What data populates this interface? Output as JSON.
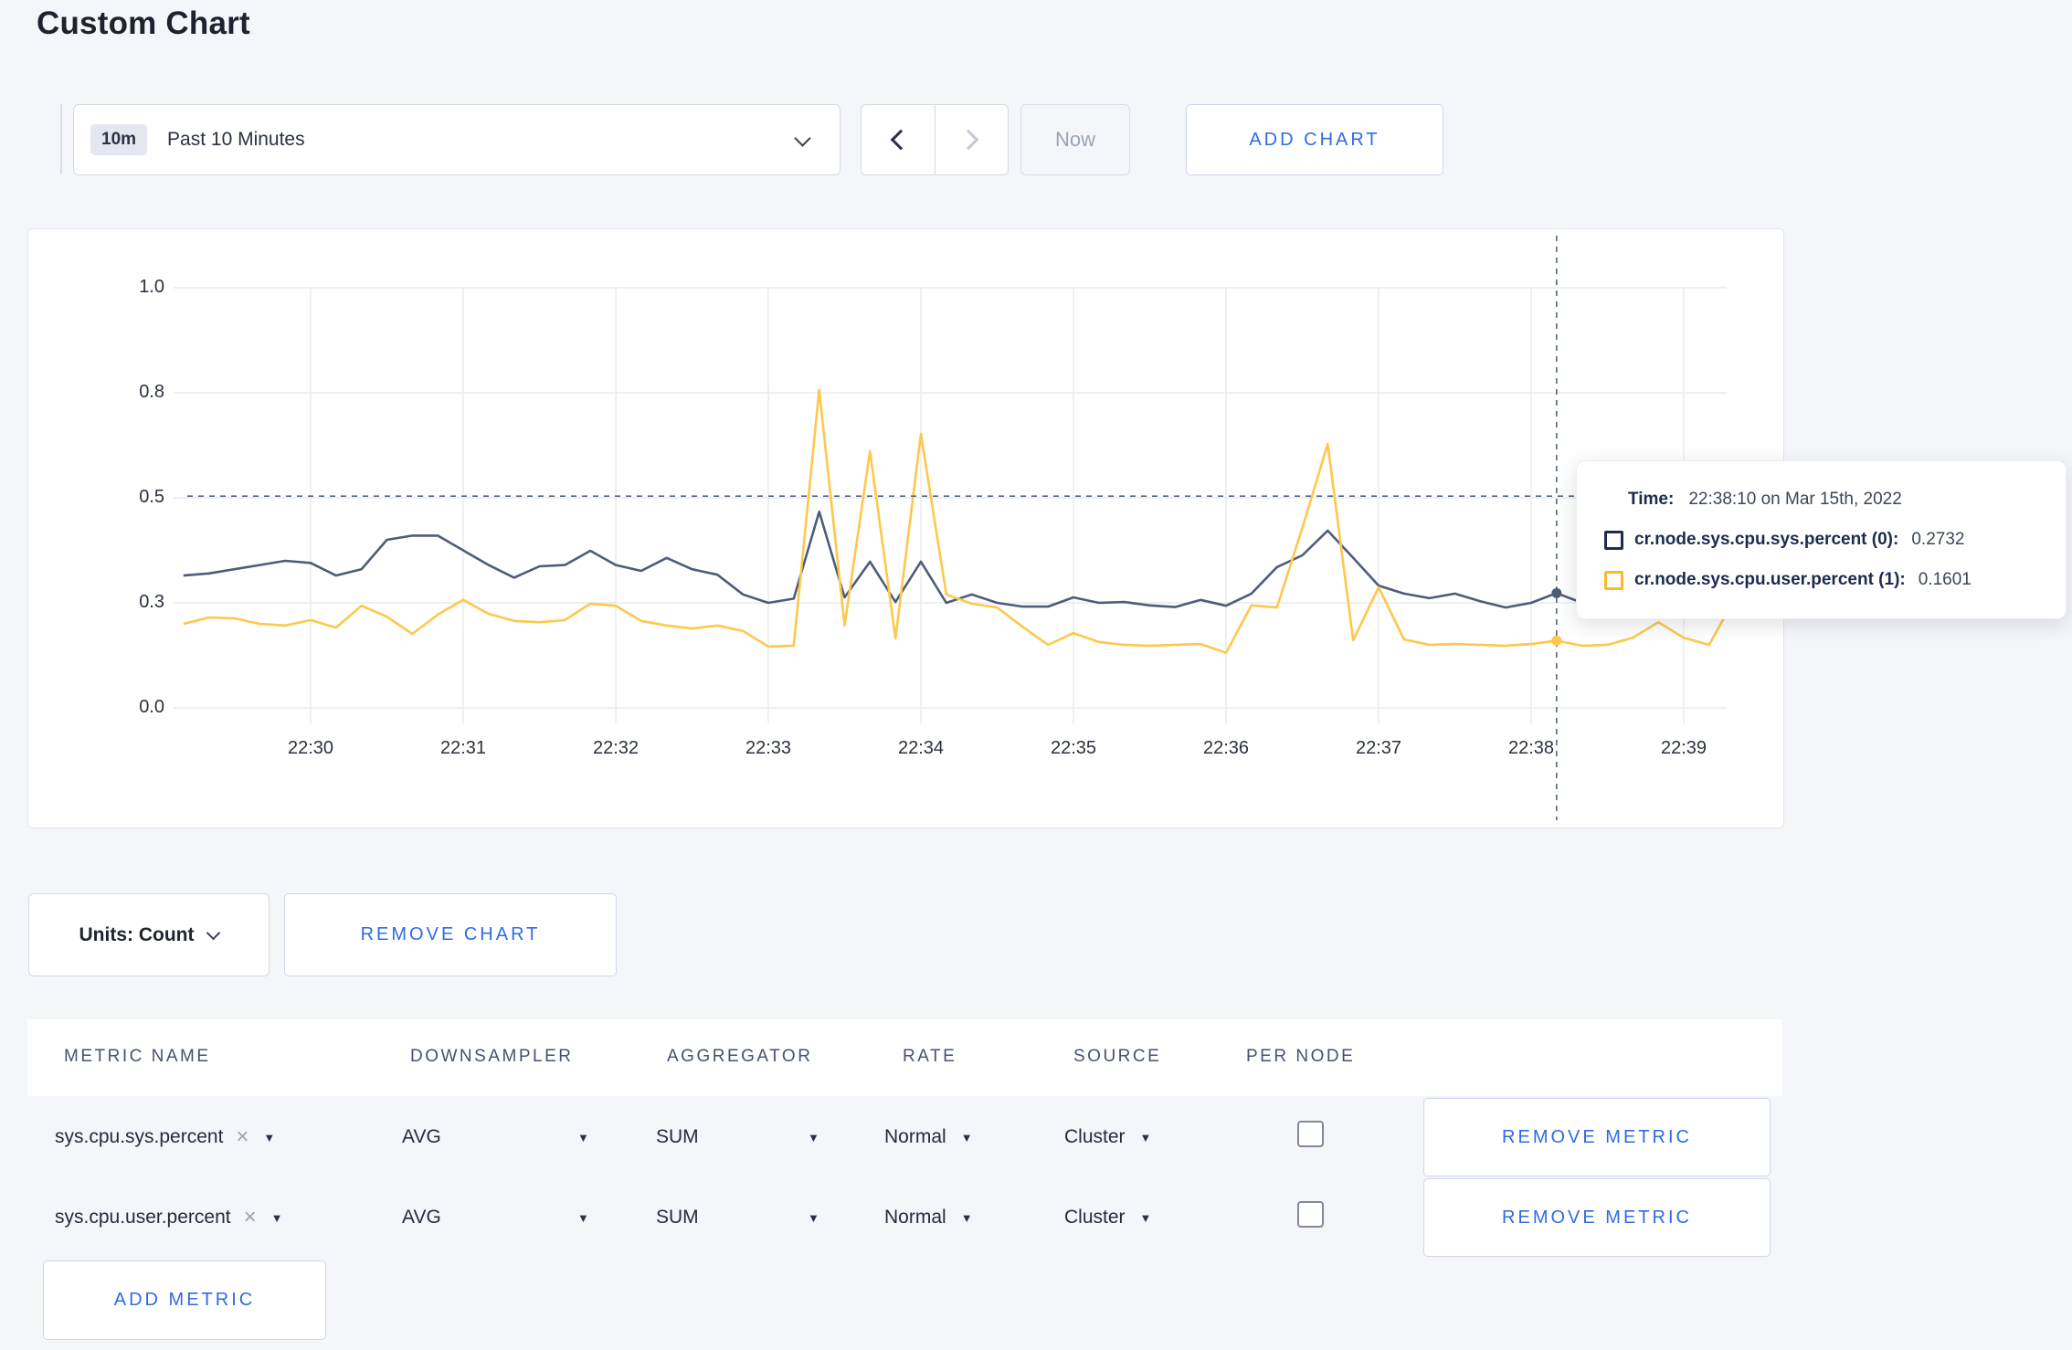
{
  "page": {
    "title": "Custom Chart"
  },
  "toolbar": {
    "time_window_badge": "10m",
    "time_window_label": "Past 10 Minutes",
    "now_label": "Now",
    "add_chart_label": "ADD CHART"
  },
  "chart_data": {
    "type": "line",
    "title": "",
    "xlabel": "",
    "ylabel": "",
    "ylim": [
      0,
      1
    ],
    "grid": true,
    "x_tick_labels": [
      "22:30",
      "22:31",
      "22:32",
      "22:33",
      "22:34",
      "22:35",
      "22:36",
      "22:37",
      "22:38",
      "22:39"
    ],
    "y_ticks": [
      {
        "label": "0.0",
        "value": 0
      },
      {
        "label": "0.3",
        "value": 0.25
      },
      {
        "label": "0.5",
        "value": 0.5
      },
      {
        "label": "0.8",
        "value": 0.75
      },
      {
        "label": "1.0",
        "value": 1.0
      }
    ],
    "x_start": "22:29:10",
    "x_step_seconds": 10,
    "x_anchor": "22:30:00",
    "series": [
      {
        "name": "cr.node.sys.cpu.sys.percent",
        "color": "#4e5c78",
        "values": [
          0.315,
          0.32,
          0.33,
          0.34,
          0.35,
          0.345,
          0.315,
          0.33,
          0.4,
          0.41,
          0.41,
          0.375,
          0.34,
          0.31,
          0.337,
          0.34,
          0.374,
          0.34,
          0.326,
          0.357,
          0.33,
          0.317,
          0.27,
          0.25,
          0.26,
          0.467,
          0.263,
          0.348,
          0.252,
          0.348,
          0.25,
          0.27,
          0.25,
          0.241,
          0.241,
          0.263,
          0.25,
          0.252,
          0.244,
          0.24,
          0.257,
          0.243,
          0.272,
          0.335,
          0.363,
          0.422,
          0.357,
          0.291,
          0.272,
          0.261,
          0.272,
          0.254,
          0.239,
          0.25,
          0.2732,
          0.25,
          0.26,
          0.274,
          0.27,
          0.252,
          0.25,
          0.27
        ]
      },
      {
        "name": "cr.node.sys.cpu.user.percent",
        "color": "#fdc84b",
        "values": [
          0.2,
          0.215,
          0.213,
          0.2,
          0.196,
          0.209,
          0.191,
          0.243,
          0.217,
          0.176,
          0.222,
          0.257,
          0.224,
          0.207,
          0.204,
          0.209,
          0.248,
          0.243,
          0.207,
          0.196,
          0.189,
          0.196,
          0.183,
          0.146,
          0.148,
          0.757,
          0.196,
          0.611,
          0.165,
          0.652,
          0.27,
          0.248,
          0.239,
          0.193,
          0.15,
          0.178,
          0.157,
          0.15,
          0.148,
          0.15,
          0.152,
          0.131,
          0.244,
          0.239,
          0.428,
          0.628,
          0.161,
          0.287,
          0.163,
          0.15,
          0.152,
          0.15,
          0.148,
          0.152,
          0.1601,
          0.148,
          0.15,
          0.167,
          0.204,
          0.167,
          0.15,
          0.26
        ]
      }
    ],
    "hover": {
      "index": 54,
      "time": "22:38:10",
      "crosshair_value": 0.504
    },
    "legend_position": "tooltip"
  },
  "tooltip": {
    "time_label": "Time:",
    "time_value": "22:38:10 on Mar 15th, 2022",
    "rows": [
      {
        "label": "cr.node.sys.cpu.sys.percent (0):",
        "value": "0.2732",
        "swatch_color": "#1f2d4d"
      },
      {
        "label": "cr.node.sys.cpu.user.percent (1):",
        "value": "0.1601",
        "swatch_color": "#fdb92c"
      }
    ]
  },
  "chart_footer": {
    "units_label": "Units: Count",
    "remove_chart_label": "REMOVE CHART"
  },
  "metrics_table": {
    "headers": [
      "METRIC NAME",
      "DOWNSAMPLER",
      "AGGREGATOR",
      "RATE",
      "SOURCE",
      "PER NODE"
    ],
    "rows": [
      {
        "metric": "sys.cpu.sys.percent",
        "downsampler": "AVG",
        "aggregator": "SUM",
        "rate": "Normal",
        "source": "Cluster",
        "per_node_checked": false,
        "remove_label": "REMOVE METRIC"
      },
      {
        "metric": "sys.cpu.user.percent",
        "downsampler": "AVG",
        "aggregator": "SUM",
        "rate": "Normal",
        "source": "Cluster",
        "per_node_checked": false,
        "remove_label": "REMOVE METRIC"
      }
    ],
    "add_metric_label": "ADD METRIC"
  },
  "colors": {
    "accent_blue": "#2e6be4",
    "series_sys": "#4e5c78",
    "series_user": "#fdc84b",
    "gridline": "#e8eaef",
    "crosshair": "#54677f",
    "background": "#f5f6fa"
  }
}
